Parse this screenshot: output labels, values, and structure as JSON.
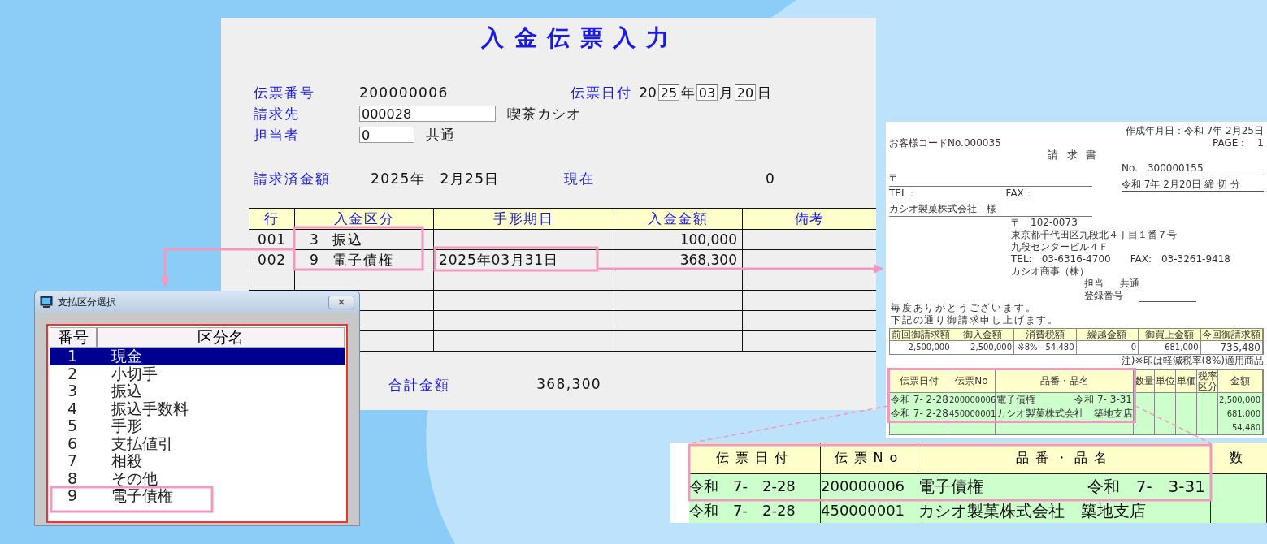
{
  "form": {
    "title": "入金伝票入力",
    "slip_number": {
      "label": "伝票番号",
      "value": "200000006"
    },
    "slip_date": {
      "label": "伝票日付",
      "century": "20",
      "year": "25",
      "year_unit": "年",
      "month": "03",
      "month_unit": "月",
      "day": "20",
      "day_unit": "日"
    },
    "billing_to": {
      "label": "請求先",
      "value": "000028",
      "name": "喫茶カシオ"
    },
    "staff": {
      "label": "担当者",
      "value": "0",
      "name": "共通"
    },
    "billed": {
      "label": "請求済金額",
      "date": "2025年　2月25日",
      "as_of": "現在",
      "amount": "0"
    },
    "table": {
      "columns": [
        "行",
        "入金区分",
        "手形期日",
        "入金金額",
        "備考"
      ],
      "rows": [
        {
          "line": "001",
          "code": "3",
          "kind_name": "振込",
          "amount": "100,000"
        },
        {
          "line": "002",
          "code": "9",
          "kind_name": "電子債権",
          "due_date": "2025年03月31日",
          "amount": "368,300"
        }
      ]
    },
    "total": {
      "label": "合計金額",
      "value": "368,300"
    }
  },
  "dialog": {
    "title": "支払区分選択",
    "columns": [
      "番号",
      "区分名"
    ],
    "items": [
      {
        "number": "1",
        "name": "現金",
        "selected": true
      },
      {
        "number": "2",
        "name": "小切手",
        "selected": false
      },
      {
        "number": "3",
        "name": "振込",
        "selected": false
      },
      {
        "number": "4",
        "name": "振込手数料",
        "selected": false
      },
      {
        "number": "5",
        "name": "手形",
        "selected": false
      },
      {
        "number": "6",
        "name": "支払値引",
        "selected": false
      },
      {
        "number": "7",
        "name": "相殺",
        "selected": false
      },
      {
        "number": "8",
        "name": "その他",
        "selected": false
      },
      {
        "number": "9",
        "name": "電子債権",
        "selected": false
      }
    ]
  },
  "invoice": {
    "customer_code": "お客様コードNo.000035",
    "created": "作成年月日：令和 7年 2月25日",
    "page": "PAGE：　1",
    "title": "請求書",
    "number": "No.　300000155",
    "period": "令和 7年 2月20日 締 切 分",
    "postal_mark": "〒",
    "tel_label": "TEL：",
    "fax_label": "FAX：",
    "customer": "カシオ製菓株式会社　様",
    "sender_lines": [
      "〒　102-0073",
      "東京都千代田区九段北４丁目１番７号",
      "九段センタービル４Ｆ",
      "TEL:　03-6316-4700　　FAX:　03-3261-9418",
      "カシオ商事（株）"
    ],
    "staff_label": "担当",
    "staff": "共通",
    "registration_label": "登録番号",
    "greeting": [
      "毎度ありがとうございます。",
      "下記の通り御請求申し上げます。"
    ],
    "summary_columns": [
      "前回御請求額",
      "御入金額",
      "消費税額",
      "繰越金額",
      "御買上金額",
      "今回御請求額"
    ],
    "summary_values": [
      "2,500,000",
      "2,500,000",
      "※8%　54,480",
      "0",
      "681,000",
      "735,480"
    ],
    "note": "注)※印は軽減税率(8%)適用商品",
    "detail_columns": [
      "伝票日付",
      "伝票No",
      "品番・品名",
      "数量",
      "単位",
      "単価",
      "税率区分",
      "金額"
    ],
    "detail_rows": [
      {
        "date": "令和 7- 2-28",
        "slip_no": "200000006",
        "item": "電子債権",
        "item_note": "令和 7- 3-31",
        "amount": "2,500,000"
      },
      {
        "date": "令和 7- 2-28",
        "slip_no": "450000001",
        "item": "カシオ製菓株式会社　築地支店",
        "amount": "681,000"
      },
      {
        "amount": "54,480"
      }
    ]
  },
  "callout": {
    "columns": [
      "伝票日付",
      "伝票No",
      "品番・品名",
      "数"
    ],
    "rows": [
      {
        "date": "令和　7-　2-28",
        "slip_no": "200000006",
        "item": "電子債権",
        "item_note": "令和　7-　3-31"
      },
      {
        "date": "令和　7-　2-28",
        "slip_no": "450000001",
        "item": "カシオ製菓株式会社　築地支店"
      }
    ]
  }
}
